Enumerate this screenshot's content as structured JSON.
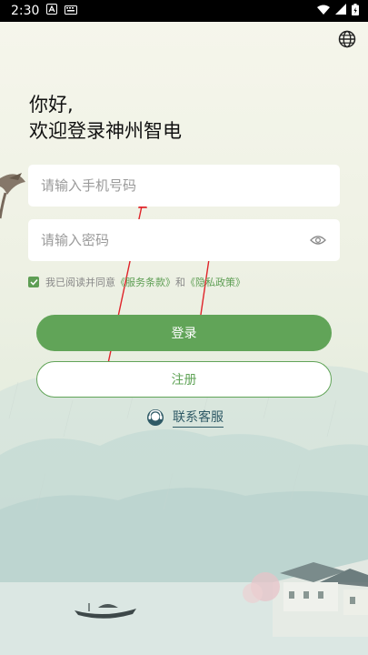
{
  "status_bar": {
    "time": "2:30",
    "icons": [
      "notification-a-icon",
      "keyboard-icon",
      "wifi-icon",
      "signal-icon",
      "battery-icon"
    ]
  },
  "header": {
    "language_icon": "globe-icon"
  },
  "greeting": {
    "line1": "你好,",
    "line2": "欢迎登录神州智电"
  },
  "form": {
    "phone_placeholder": "请输入手机号码",
    "password_placeholder": "请输入密码",
    "agreement_prefix": "我已阅读并同意",
    "terms_link": "《服务条款》",
    "agreement_and": "和",
    "privacy_link": "《隐私政策》",
    "agreement_checked": true
  },
  "buttons": {
    "login": "登录",
    "register": "注册"
  },
  "service": {
    "label": "联系客服",
    "icon": "customer-service-icon"
  },
  "colors": {
    "accent": "#61a458",
    "link_dark": "#2f5a66",
    "status_bar": "#000000"
  }
}
